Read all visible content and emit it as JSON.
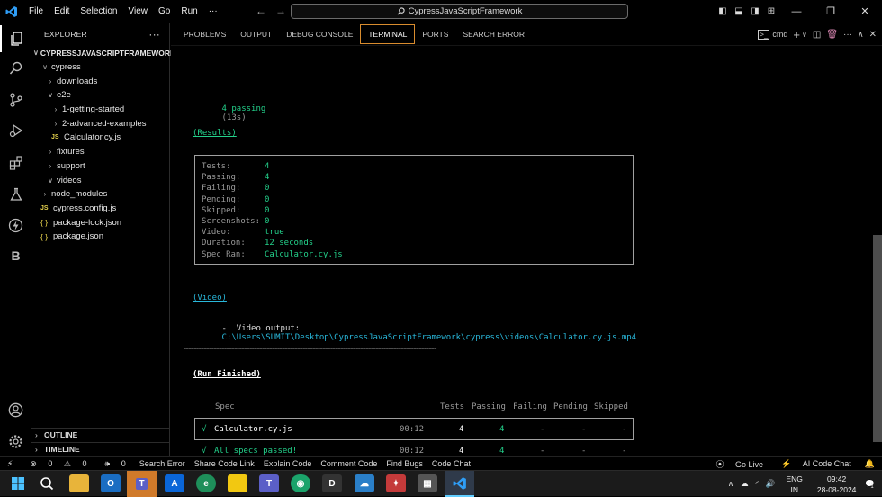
{
  "titlebar": {
    "menu": [
      "File",
      "Edit",
      "Selection",
      "View",
      "Go",
      "Run",
      "···"
    ],
    "search_text": "CypressJavaScriptFramework"
  },
  "explorer": {
    "header": "EXPLORER",
    "root": "CYPRESSJAVASCRIPTFRAMEWORK",
    "items": [
      {
        "label": "cypress",
        "kind": "folder-open",
        "level": 1
      },
      {
        "label": "downloads",
        "kind": "folder",
        "level": 2
      },
      {
        "label": "e2e",
        "kind": "folder-open",
        "level": 2
      },
      {
        "label": "1-getting-started",
        "kind": "folder",
        "level": 3
      },
      {
        "label": "2-advanced-examples",
        "kind": "folder",
        "level": 3
      },
      {
        "label": "Calculator.cy.js",
        "kind": "js",
        "level": 3
      },
      {
        "label": "fixtures",
        "kind": "folder",
        "level": 2
      },
      {
        "label": "support",
        "kind": "folder",
        "level": 2
      },
      {
        "label": "videos",
        "kind": "folder-open",
        "level": 2
      },
      {
        "label": "node_modules",
        "kind": "folder",
        "level": 1
      },
      {
        "label": "cypress.config.js",
        "kind": "js",
        "level": 1
      },
      {
        "label": "package-lock.json",
        "kind": "json",
        "level": 1
      },
      {
        "label": "package.json",
        "kind": "json",
        "level": 1
      }
    ],
    "outline": "OUTLINE",
    "timeline": "TIMELINE"
  },
  "panel": {
    "tabs": [
      "PROBLEMS",
      "OUTPUT",
      "DEBUG CONSOLE",
      "TERMINAL",
      "PORTS",
      "SEARCH ERROR"
    ],
    "active_tab": "TERMINAL",
    "shell": "cmd"
  },
  "terminal": {
    "passing": "4 passing",
    "passing_time": "(13s)",
    "results_heading": "(Results)",
    "results": [
      {
        "key": "Tests:",
        "value": "4"
      },
      {
        "key": "Passing:",
        "value": "4"
      },
      {
        "key": "Failing:",
        "value": "0"
      },
      {
        "key": "Pending:",
        "value": "0"
      },
      {
        "key": "Skipped:",
        "value": "0"
      },
      {
        "key": "Screenshots:",
        "value": "0"
      },
      {
        "key": "Video:",
        "value": "true"
      },
      {
        "key": "Duration:",
        "value": "12 seconds"
      },
      {
        "key": "Spec Ran:",
        "value": "Calculator.cy.js"
      }
    ],
    "video_heading": "(Video)",
    "video_label": "-  Video output:",
    "video_path": "C:\\Users\\SUMIT\\Desktop\\CypressJavaScriptFramework\\cypress\\videos\\Calculator.cy.js.mp4",
    "separator": "====================================================================================================",
    "run_finished": "(Run Finished)",
    "table_headers": [
      "Spec",
      "Tests",
      "Passing",
      "Failing",
      "Pending",
      "Skipped"
    ],
    "spec_row": {
      "check": "√",
      "spec": "Calculator.cy.js",
      "time": "00:12",
      "tests": "4",
      "passing": "4",
      "failing": "-",
      "pending": "-",
      "skipped": "-"
    },
    "total_row": {
      "check": "√",
      "label": "All specs passed!",
      "time": "00:12",
      "tests": "4",
      "passing": "4",
      "failing": "-",
      "pending": "-",
      "skipped": "-"
    }
  },
  "statusbar": {
    "errors": "0",
    "warnings": "0",
    "ports": "0",
    "items": [
      "Search Error",
      "Share Code Link",
      "Explain Code",
      "Comment Code",
      "Find Bugs",
      "Code Chat"
    ],
    "go_live": "Go Live",
    "ai_chat": "AI Code Chat"
  },
  "taskbar": {
    "lang": "ENG",
    "region": "IN",
    "time": "09:42",
    "date": "28-08-2024",
    "notif_count": "1"
  },
  "colors": {
    "accent": "#d98c2e",
    "terminal_green": "#23d18b",
    "terminal_cyan": "#29b8db",
    "vscode_blue": "#2f9df5"
  }
}
